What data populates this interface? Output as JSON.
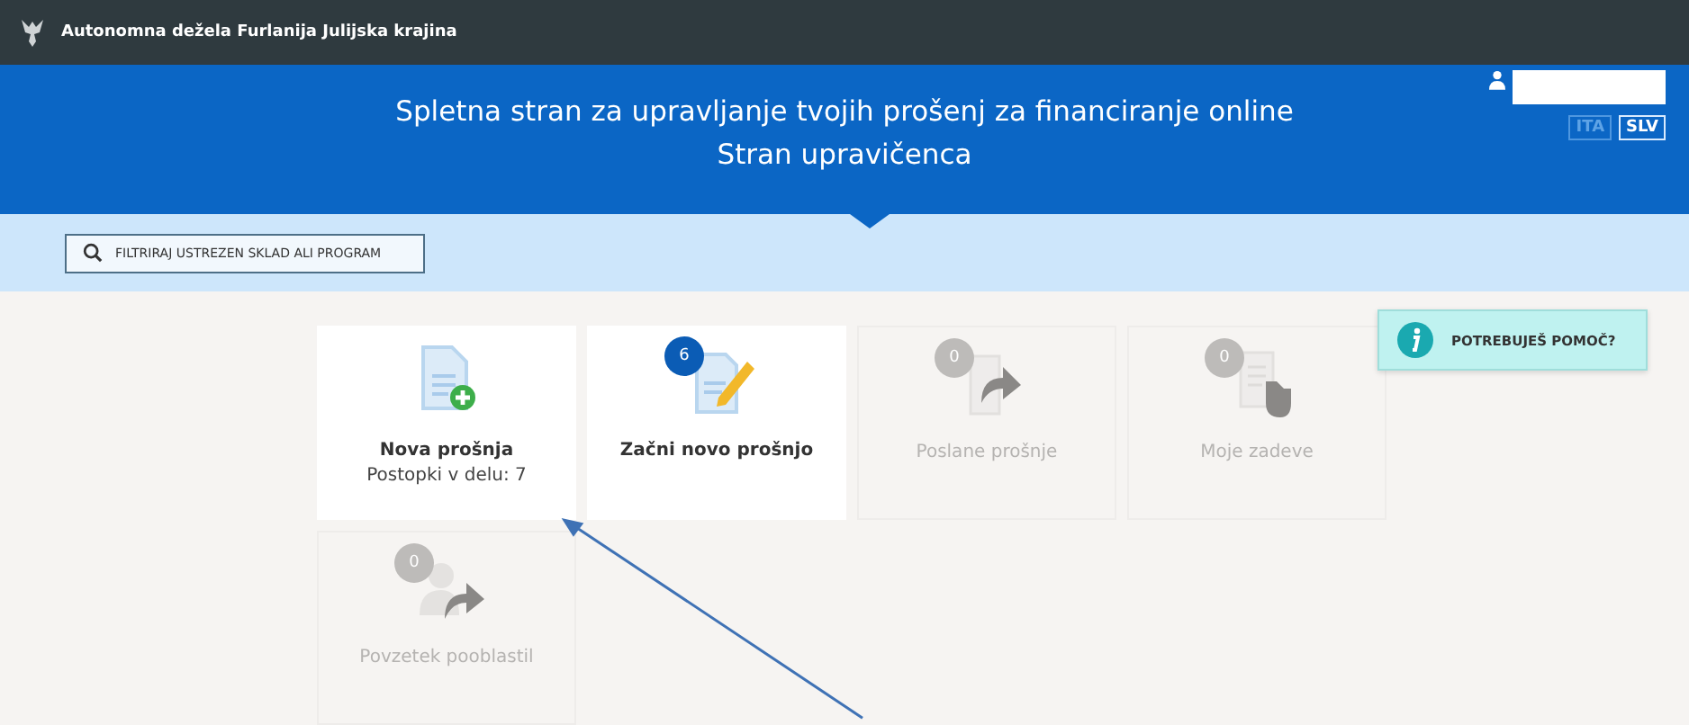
{
  "top_bar": {
    "title": "Autonomna dežela Furlanija Julijska krajina"
  },
  "header": {
    "title_lines": [
      "Spletna stran za upravljanje tvojih prošenj za financiranje online",
      "Stran upravičenca"
    ],
    "languages": [
      {
        "label": "ITA",
        "selected": false
      },
      {
        "label": "SLV",
        "selected": true
      }
    ]
  },
  "filter": {
    "label": "FILTRIRAJ USTREZEN SKLAD ALI PROGRAM"
  },
  "cards": [
    {
      "kind": "new",
      "title": "Nova prošnja",
      "subtitle": "Postopki v delu: 7",
      "disabled": false
    },
    {
      "kind": "edit",
      "title": "Začni novo prošnjo",
      "badge": "6",
      "disabled": false
    },
    {
      "kind": "sent",
      "title": "Poslane prošnje",
      "badge": "0",
      "disabled": true
    },
    {
      "kind": "cases",
      "title": "Moje zadeve",
      "badge": "0",
      "disabled": true
    },
    {
      "kind": "delegate",
      "title": "Povzetek pooblastil",
      "badge": "0",
      "disabled": true
    }
  ],
  "help": {
    "label": "POTREBUJEŠ POMOČ?"
  }
}
